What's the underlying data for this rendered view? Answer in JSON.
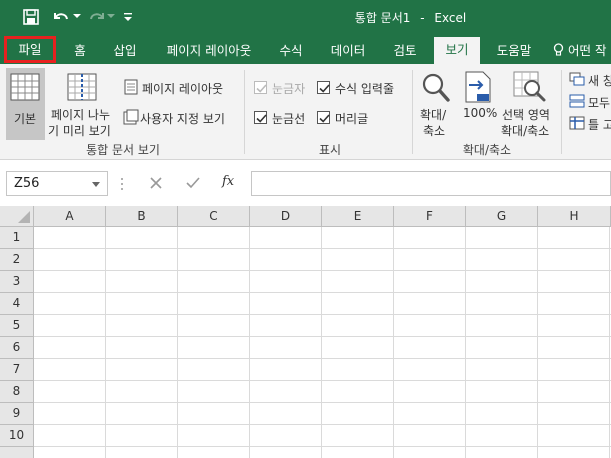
{
  "title": {
    "doc": "통합 문서1",
    "sep": "-",
    "app": "Excel"
  },
  "qat_icons": [
    "save-icon",
    "undo-icon",
    "redo-icon",
    "customize-qat-icon"
  ],
  "tabs": [
    "파일",
    "홈",
    "삽입",
    "페이지 레이아웃",
    "수식",
    "데이터",
    "검토",
    "보기",
    "도움말"
  ],
  "tell_me": "어떤 작",
  "ribbon": {
    "normal": "기본",
    "page_break_line1": "페이지 나누",
    "page_break_line2": "기 미리 보기",
    "page_layout": "페이지 레이아웃",
    "custom_views": "사용자 지정 보기",
    "group_workbook_views": "통합 문서 보기",
    "ruler": "눈금자",
    "formula_bar": "수식 입력줄",
    "gridlines": "눈금선",
    "headings": "머리글",
    "group_show": "표시",
    "zoom_line1": "확대/",
    "zoom_line2": "축소",
    "zoom100": "100%",
    "zoom_sel_line1": "선택 영역",
    "zoom_sel_line2": "확대/축소",
    "group_zoom": "확대/축소",
    "new_window": "새 창",
    "arrange_all": "모두",
    "freeze": "틀 고"
  },
  "checkboxes": {
    "ruler": false,
    "formula_bar": true,
    "gridlines": true,
    "headings": true
  },
  "namebox": "Z56",
  "fx_label": "fx",
  "columns": [
    "A",
    "B",
    "C",
    "D",
    "E",
    "F",
    "G",
    "H"
  ],
  "rows": [
    "1",
    "2",
    "3",
    "4",
    "5",
    "6",
    "7",
    "8",
    "9",
    "10"
  ],
  "colors": {
    "brand": "#217346",
    "highlight": "#e8211f",
    "ribbon_bg": "#f3f3f3"
  }
}
